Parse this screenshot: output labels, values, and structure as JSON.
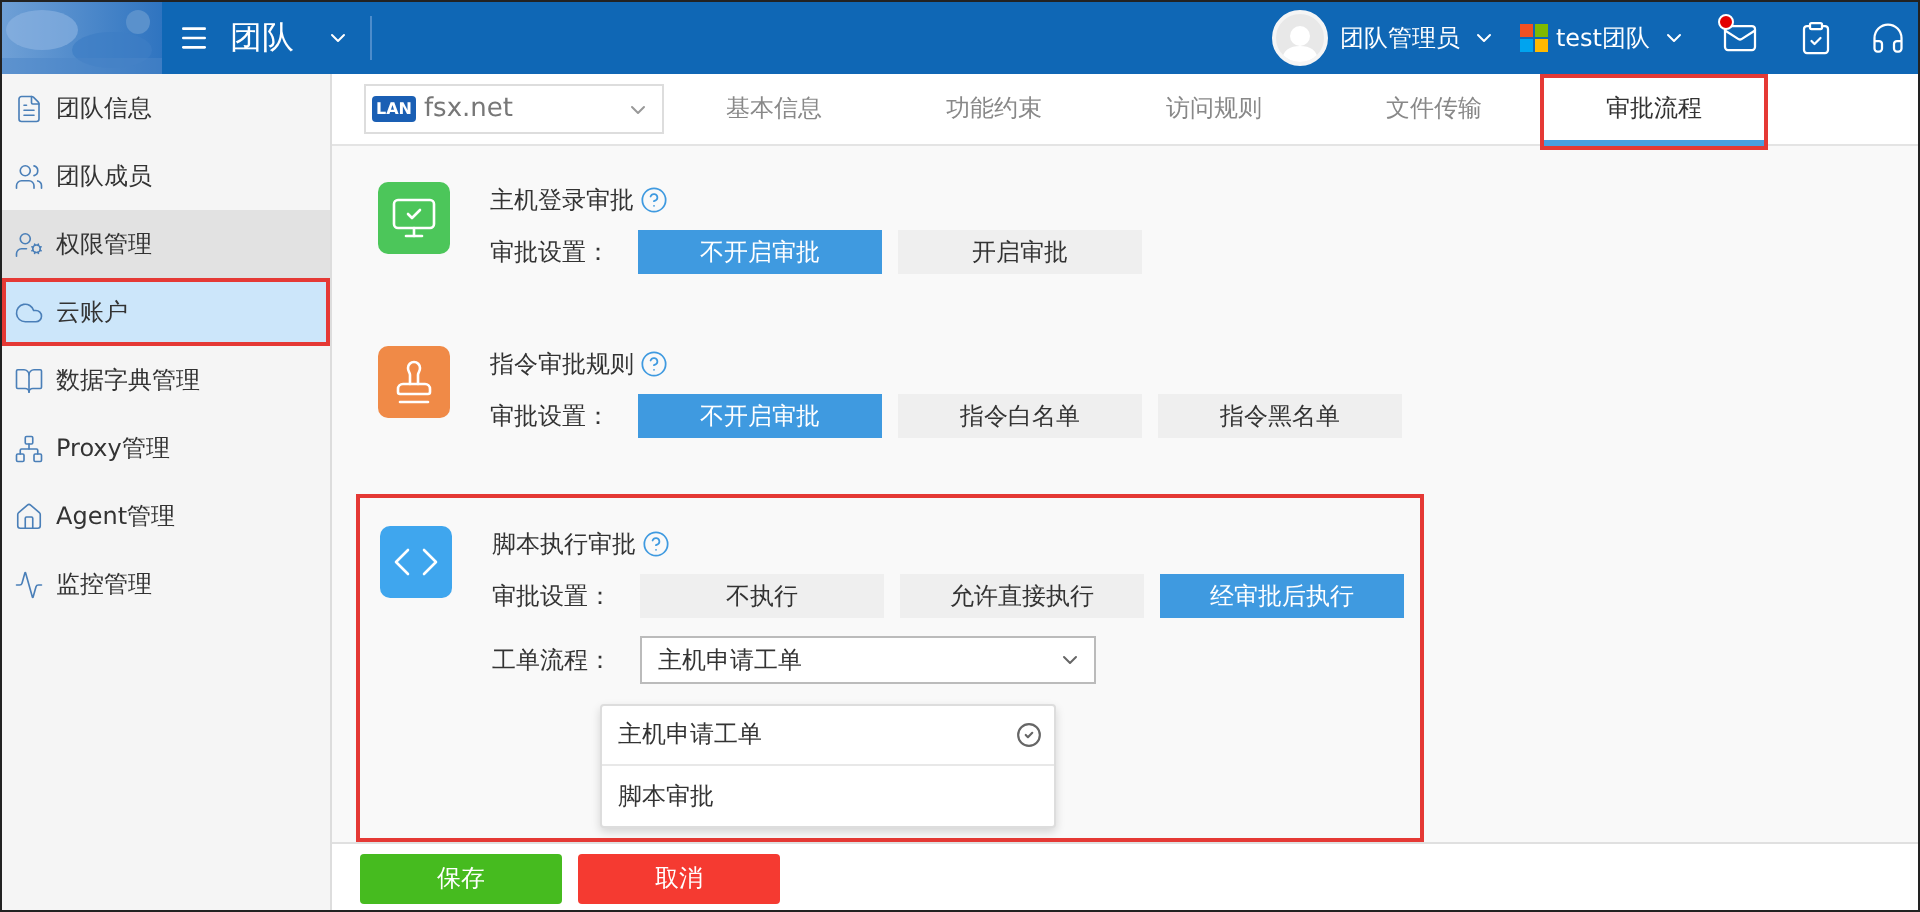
{
  "header": {
    "module": "团队",
    "user": "团队管理员",
    "team": "test团队",
    "has_unread": true
  },
  "sidebar": {
    "items": [
      {
        "label": "团队信息",
        "selected": false,
        "hovered": false,
        "highlighted": false
      },
      {
        "label": "团队成员",
        "selected": false,
        "hovered": false,
        "highlighted": false
      },
      {
        "label": "权限管理",
        "selected": false,
        "hovered": true,
        "highlighted": false
      },
      {
        "label": "云账户",
        "selected": true,
        "hovered": false,
        "highlighted": true
      },
      {
        "label": "数据字典管理",
        "selected": false,
        "hovered": false,
        "highlighted": false
      },
      {
        "label": "Proxy管理",
        "selected": false,
        "hovered": false,
        "highlighted": false
      },
      {
        "label": "Agent管理",
        "selected": false,
        "hovered": false,
        "highlighted": false
      },
      {
        "label": "监控管理",
        "selected": false,
        "hovered": false,
        "highlighted": false
      }
    ]
  },
  "site_select": {
    "badge": "LAN",
    "value": "fsx.net"
  },
  "tabs": [
    {
      "label": "基本信息",
      "selected": false,
      "highlighted": false
    },
    {
      "label": "功能约束",
      "selected": false,
      "highlighted": false
    },
    {
      "label": "访问规则",
      "selected": false,
      "highlighted": false
    },
    {
      "label": "文件传输",
      "selected": false,
      "highlighted": false
    },
    {
      "label": "审批流程",
      "selected": true,
      "highlighted": true
    }
  ],
  "sections": [
    {
      "title": "主机登录审批",
      "color": "#4cc65a",
      "setting_label": "审批设置：",
      "options": [
        {
          "label": "不开启审批",
          "selected": true
        },
        {
          "label": "开启审批",
          "selected": false
        }
      ]
    },
    {
      "title": "指令审批规则",
      "color": "#f08a47",
      "setting_label": "审批设置：",
      "options": [
        {
          "label": "不开启审批",
          "selected": true
        },
        {
          "label": "指令白名单",
          "selected": false
        },
        {
          "label": "指令黑名单",
          "selected": false
        }
      ]
    },
    {
      "title": "脚本执行审批",
      "color": "#3fa6ee",
      "highlighted": true,
      "setting_label": "审批设置：",
      "options": [
        {
          "label": "不执行",
          "selected": false
        },
        {
          "label": "允许直接执行",
          "selected": false
        },
        {
          "label": "经审批后执行",
          "selected": true
        }
      ],
      "workflow": {
        "label": "工单流程：",
        "value": "主机申请工单",
        "expanded": true,
        "options": [
          {
            "label": "主机申请工单",
            "selected": true
          },
          {
            "label": "脚本审批",
            "selected": false
          }
        ]
      }
    }
  ],
  "footer": {
    "save": "保存",
    "cancel": "取消"
  }
}
